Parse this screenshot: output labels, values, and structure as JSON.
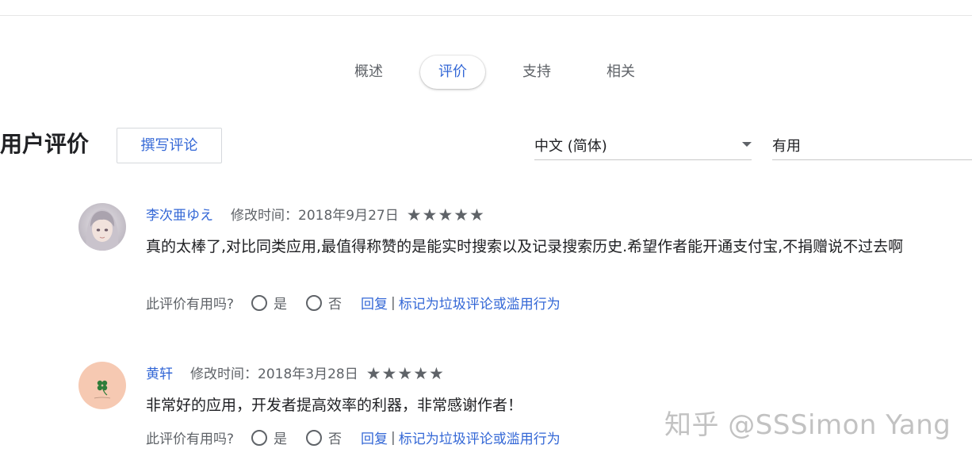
{
  "tabs": [
    {
      "label": "概述",
      "selected": false
    },
    {
      "label": "评价",
      "selected": true
    },
    {
      "label": "支持",
      "selected": false
    },
    {
      "label": "相关",
      "selected": false
    }
  ],
  "section": {
    "title": "用户评价",
    "write_button": "撰写评论"
  },
  "filters": {
    "language": "中文 (简体)",
    "sort": "有用"
  },
  "reviews": [
    {
      "author": "李次亜ゆえ",
      "date": "修改时间：2018年9月27日",
      "stars": "★★★★★",
      "rating": 5,
      "text": "真的太棒了,对比同类应用,最值得称赞的是能实时搜索以及记录搜索历史.希望作者能开通支付宝,不捐赠说不过去啊",
      "helpful_prompt": "此评价有用吗?",
      "yes_label": "是",
      "no_label": "否",
      "reply_label": "回复",
      "separator": "|",
      "report_label": "标记为垃圾评论或滥用行为"
    },
    {
      "author": "黄轩",
      "date": "修改时间：2018年3月28日",
      "stars": "★★★★★",
      "rating": 5,
      "text": "非常好的应用，开发者提高效率的利器，非常感谢作者！",
      "helpful_prompt": "此评价有用吗?",
      "yes_label": "是",
      "no_label": "否",
      "reply_label": "回复",
      "separator": "|",
      "report_label": "标记为垃圾评论或滥用行为"
    }
  ],
  "watermark": "知乎 @SSSimon Yang",
  "colors": {
    "accent": "#3367d6",
    "secondary_text": "#5f6368",
    "primary_text": "#202124"
  }
}
